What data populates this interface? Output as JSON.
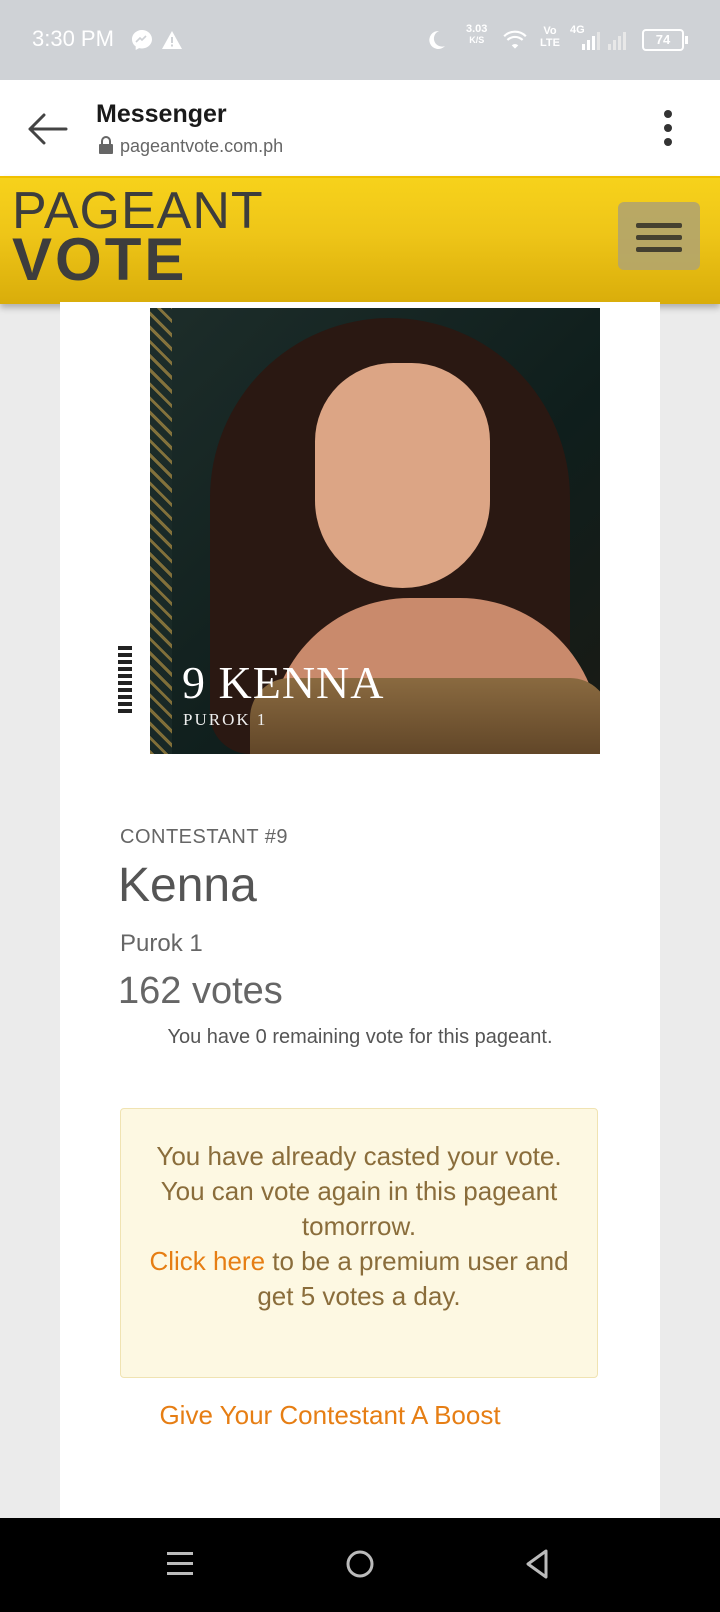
{
  "status_bar": {
    "time": "3:30 PM",
    "icons": [
      "messenger-icon",
      "warning-icon",
      "moon-icon",
      "wifi-icon",
      "volte-icon",
      "signal-icon"
    ],
    "speed_value": "3.03",
    "speed_unit": "K/S",
    "volte_top": "Vo",
    "volte_bottom": "LTE",
    "network": "4G",
    "battery": "74"
  },
  "browser": {
    "title": "Messenger",
    "url": "pageantvote.com.ph",
    "icons": [
      "back-arrow-icon",
      "lock-icon",
      "more-vert-icon"
    ]
  },
  "site": {
    "logo_top": "PAGEANT",
    "logo_bottom": "VOTE",
    "menu_icon": "hamburger-icon",
    "header_color": "#f2c918"
  },
  "contestant": {
    "photo_number": "9 KENNA",
    "photo_sub": "PUROK 1",
    "label": "CONTESTANT #9",
    "name": "Kenna",
    "place": "Purok 1",
    "votes": "162 votes",
    "remaining": "You have 0 remaining vote for this pageant."
  },
  "notice": {
    "line1": "You have already casted your vote.",
    "line2": "You can vote again in this pageant tomorrow.",
    "link_text": "Click here",
    "line3_rest": " to be a premium user and get 5 votes a day."
  },
  "boost_link": "Give Your Contestant A Boost",
  "accent_color": "#e67e14",
  "nav": {
    "icons": [
      "recents-icon",
      "home-icon",
      "back-icon"
    ]
  }
}
